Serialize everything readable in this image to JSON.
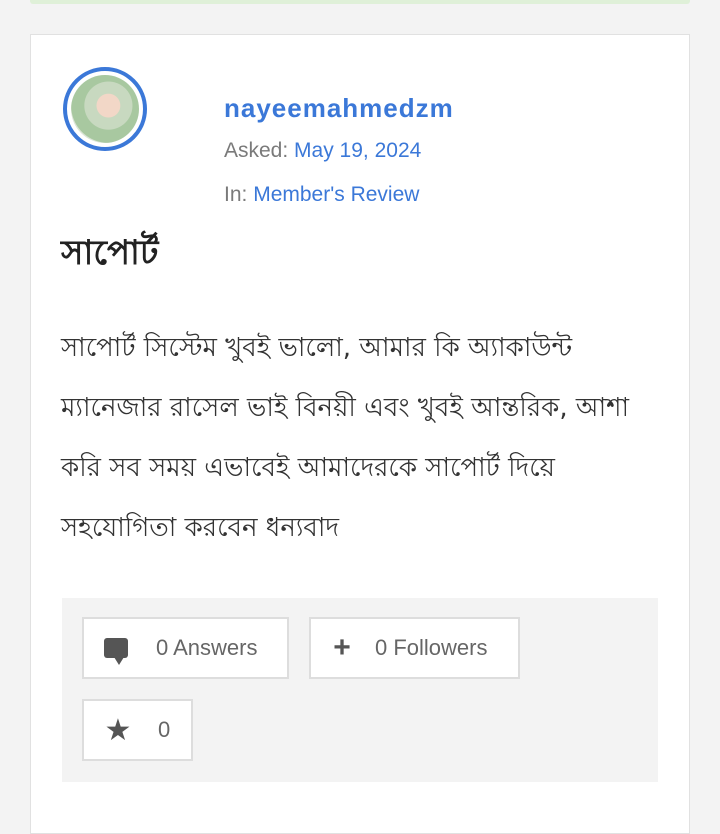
{
  "question": {
    "username": "nayeemahmedzm",
    "asked_label": "Asked:",
    "asked_date": "May 19, 2024",
    "in_label": "In:",
    "category": "Member's Review",
    "title": "সাপোর্ট",
    "body": "সাপোর্ট সিস্টেম খুবই ভালো, আমার কি অ্যাকাউন্ট ম্যানেজার রাসেল ভাই বিনয়ী এবং খুবই আন্তরিক, আশা করি সব সময় এভাবেই আমাদেরকে সাপোর্ট দিয়ে সহযোগিতা করবেন ধন্যবাদ"
  },
  "stats": {
    "answers": "0 Answers",
    "followers": "0 Followers",
    "favorites": "0"
  },
  "icons": {
    "answers": "comment-icon",
    "followers": "plus-icon",
    "favorites": "star-icon"
  },
  "colors": {
    "accent": "#3b78d8",
    "top_bar": "#dff0d8"
  }
}
